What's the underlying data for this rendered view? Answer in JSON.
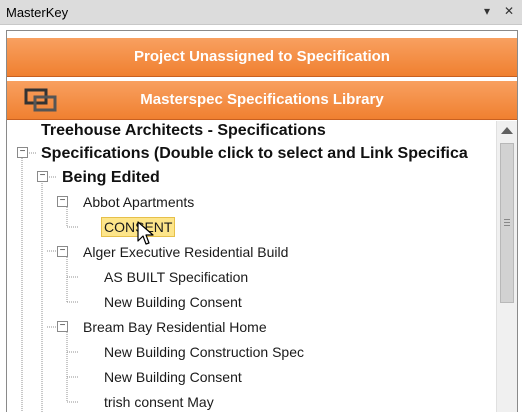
{
  "window": {
    "title": "MasterKey",
    "dropdown_glyph": "▾",
    "close_glyph": "✕"
  },
  "banners": {
    "project": "Project Unassigned to Specification",
    "library": "Masterspec Specifications Library",
    "library_icon": "linked-windows-icon"
  },
  "tree": {
    "root_title": "Treehouse Architects - Specifications",
    "specifications": "Specifications (Double click to select and Link Specifica",
    "being_edited": "Being Edited",
    "projects": [
      {
        "name": "Abbot Apartments",
        "children": [
          "CONSENT"
        ]
      },
      {
        "name": "Alger Executive Residential Build",
        "children": [
          "AS BUILT Specification",
          "New Building Consent"
        ]
      },
      {
        "name": "Bream Bay Residential Home",
        "children": [
          "New Building Construction Spec",
          "New Building Consent",
          "trish consent May"
        ]
      }
    ],
    "selected_item": "CONSENT",
    "expander_glyph": "−"
  },
  "colors": {
    "banner_orange": "#f08030",
    "selected_bg": "#fde58a"
  }
}
